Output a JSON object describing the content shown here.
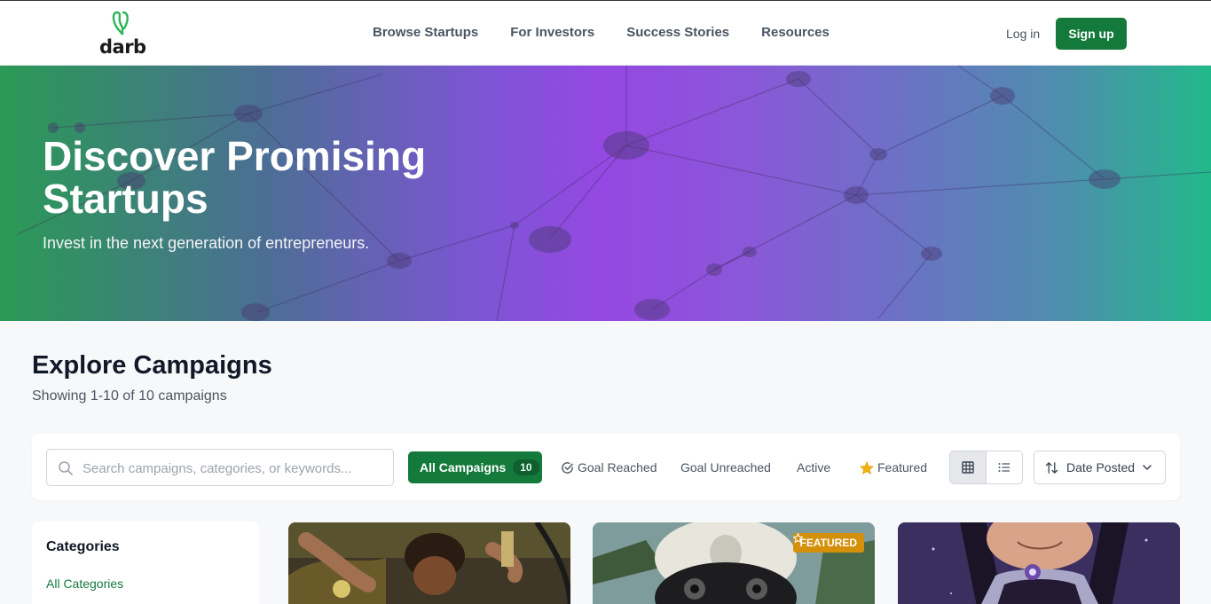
{
  "brand": {
    "name": "darb",
    "accent": "#147a3c"
  },
  "nav": {
    "items": [
      {
        "label": "Browse Startups"
      },
      {
        "label": "For Investors"
      },
      {
        "label": "Success Stories"
      },
      {
        "label": "Resources"
      }
    ],
    "login_label": "Log in",
    "signup_label": "Sign up"
  },
  "hero": {
    "title": "Discover Promising Startups",
    "subtitle": "Invest in the next generation of entrepreneurs."
  },
  "explore": {
    "title": "Explore Campaigns",
    "summary": "Showing 1-10 of 10 campaigns"
  },
  "filters": {
    "search_placeholder": "Search campaigns, categories, or keywords...",
    "tabs": [
      {
        "label": "All Campaigns",
        "count": "10",
        "active": true
      },
      {
        "label": "Goal Reached",
        "icon": "check-circle-icon"
      },
      {
        "label": "Goal Unreached"
      },
      {
        "label": "Active"
      },
      {
        "label": "Featured",
        "icon": "star-icon"
      }
    ],
    "view_modes": [
      "grid-icon",
      "list-icon"
    ],
    "sort_label": "Date Posted"
  },
  "sidebar": {
    "title": "Categories",
    "items": [
      {
        "label": "All Categories"
      }
    ]
  },
  "cards": [
    {
      "featured": false
    },
    {
      "featured": true,
      "badge": "FEATURED"
    },
    {
      "featured": false
    }
  ]
}
